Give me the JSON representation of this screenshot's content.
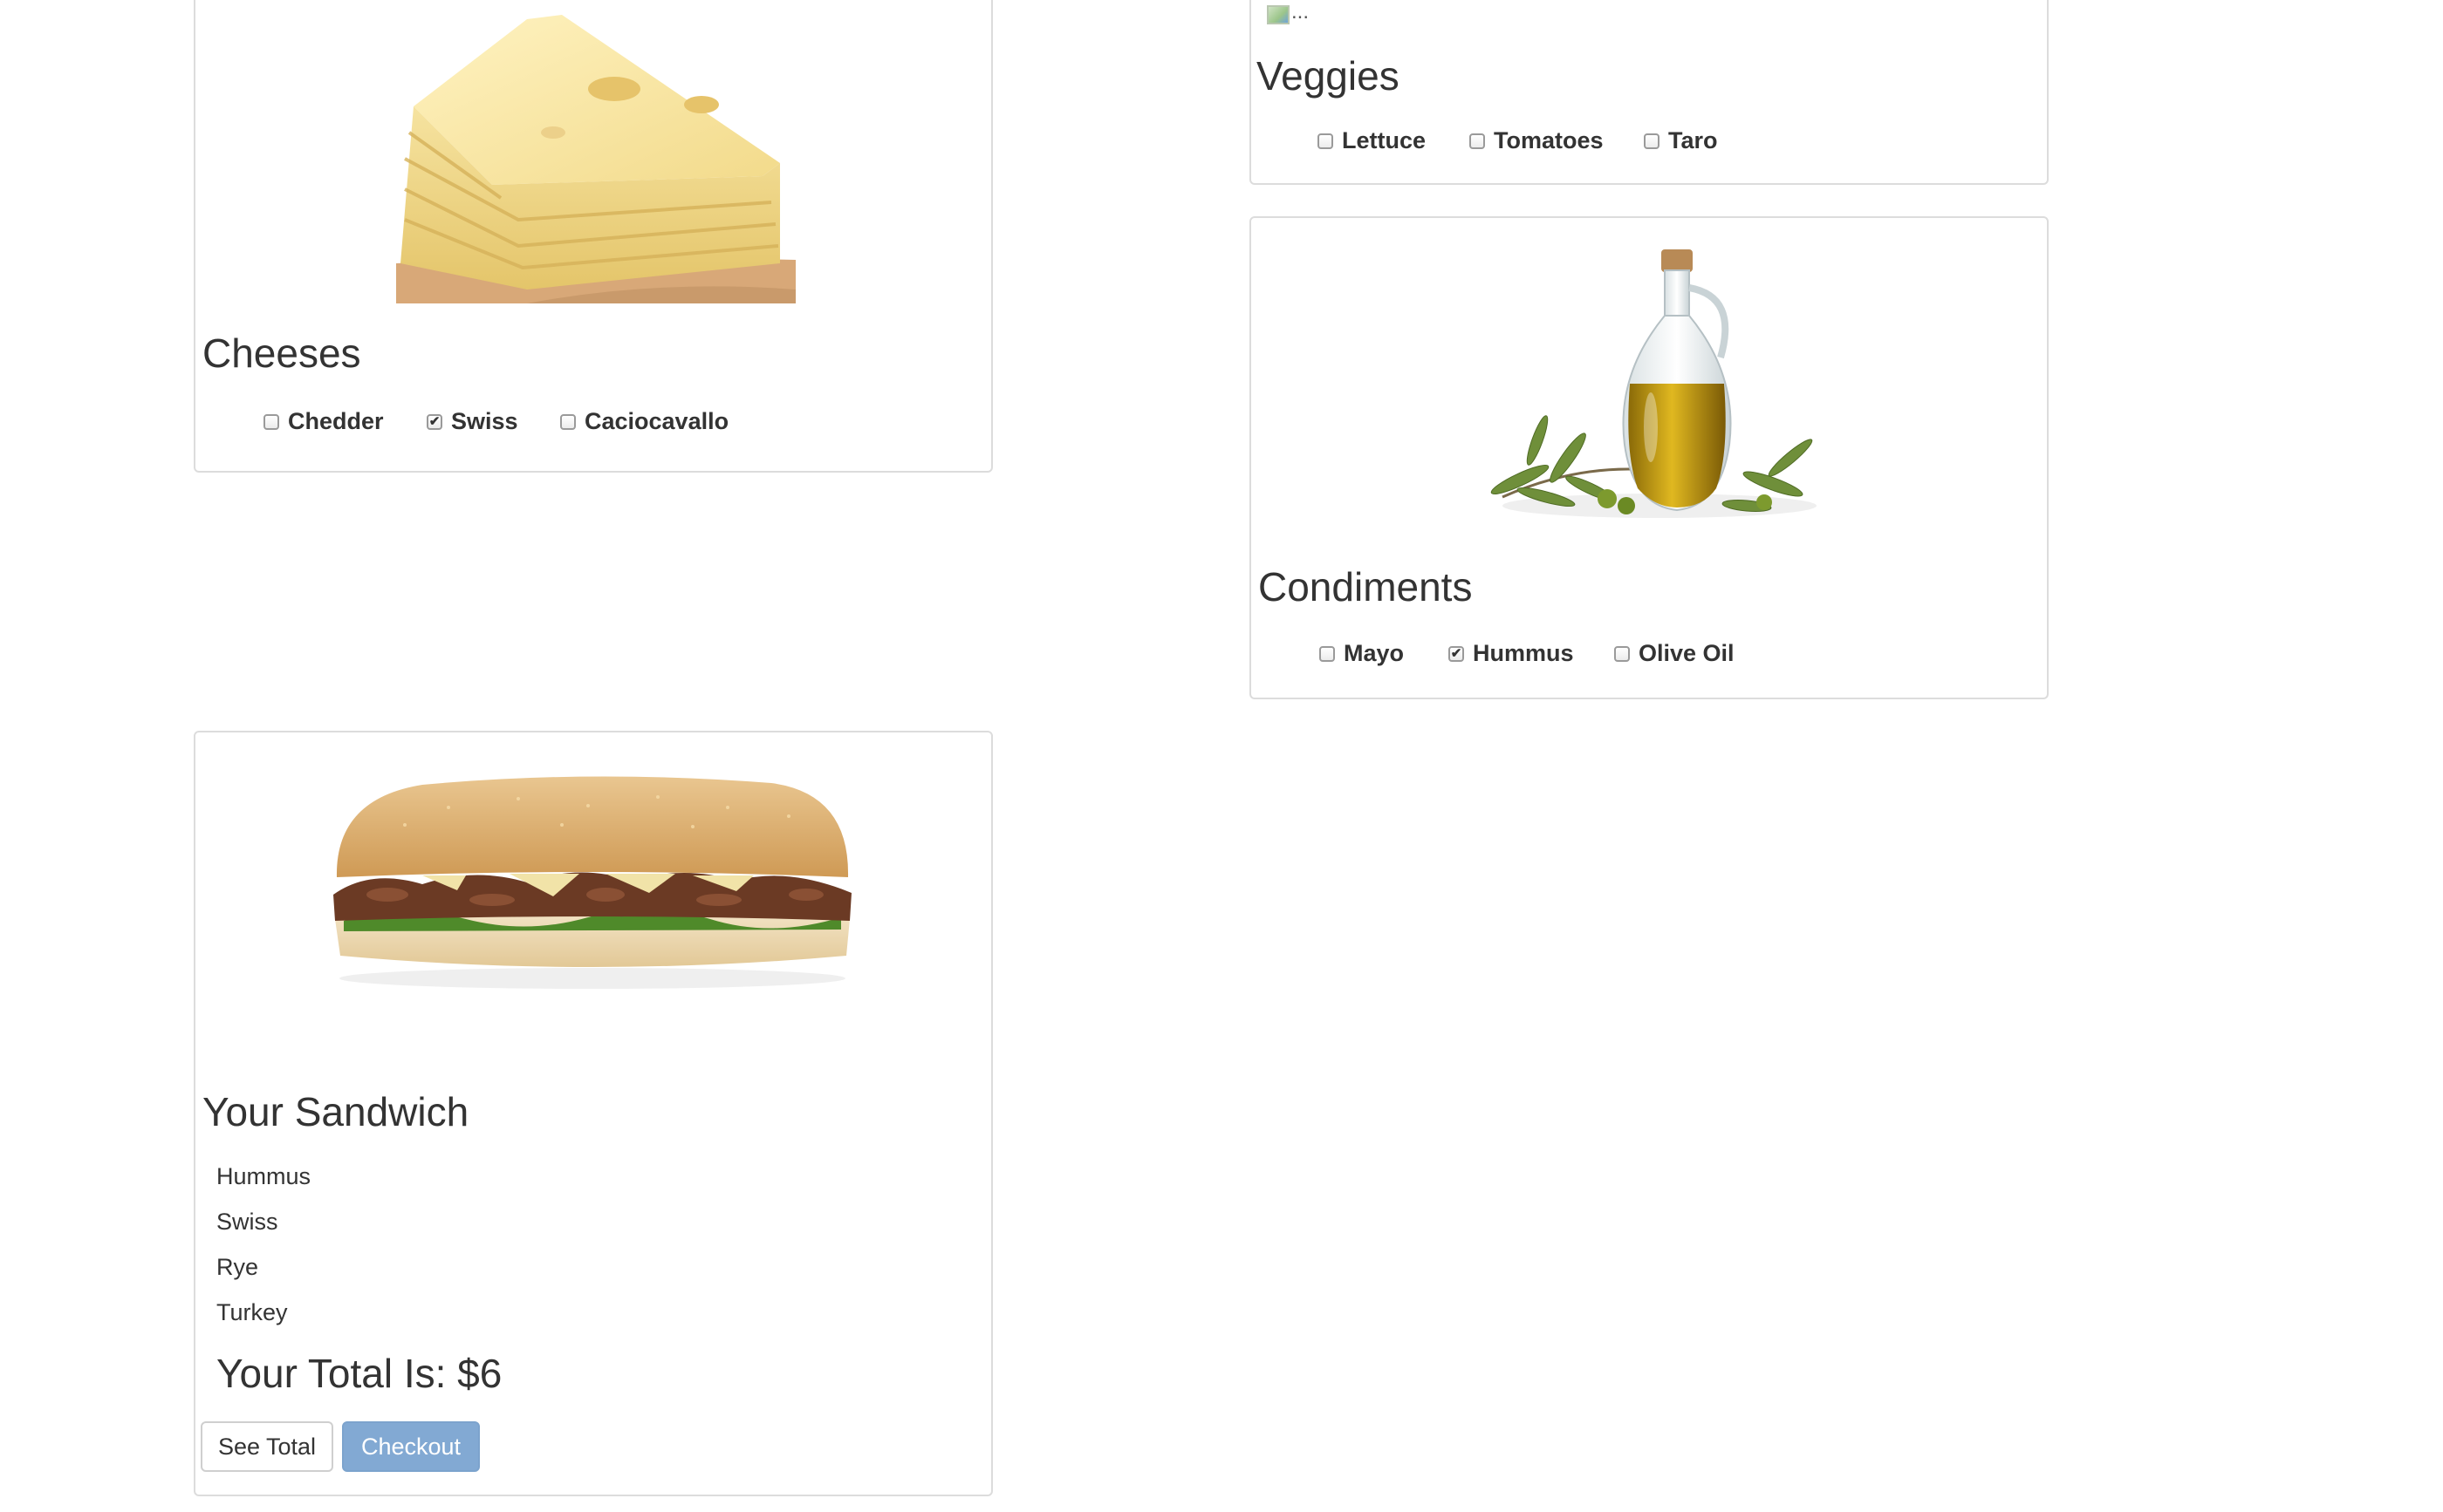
{
  "cheeses": {
    "title": "Cheeses",
    "image": "swiss-cheese-image",
    "options": [
      {
        "label": "Chedder",
        "checked": false
      },
      {
        "label": "Swiss",
        "checked": true
      },
      {
        "label": "Caciocavallo",
        "checked": false
      }
    ]
  },
  "veggies": {
    "title": "Veggies",
    "image_alt": "...",
    "options": [
      {
        "label": "Lettuce",
        "checked": false
      },
      {
        "label": "Tomatoes",
        "checked": false
      },
      {
        "label": "Taro",
        "checked": false
      }
    ]
  },
  "condiments": {
    "title": "Condiments",
    "image": "olive-oil-image",
    "options": [
      {
        "label": "Mayo",
        "checked": false
      },
      {
        "label": "Hummus",
        "checked": true
      },
      {
        "label": "Olive Oil",
        "checked": false
      }
    ]
  },
  "sandwich": {
    "title": "Your Sandwich",
    "image": "sandwich-image",
    "items": [
      "Hummus",
      "Swiss",
      "Rye",
      "Turkey"
    ],
    "total_text": "Your Total Is: $6",
    "see_total_label": "See Total",
    "checkout_label": "Checkout"
  },
  "colors": {
    "primary_button": "#82a9d3",
    "panel_border": "#dcdcdc",
    "text": "#333333"
  }
}
